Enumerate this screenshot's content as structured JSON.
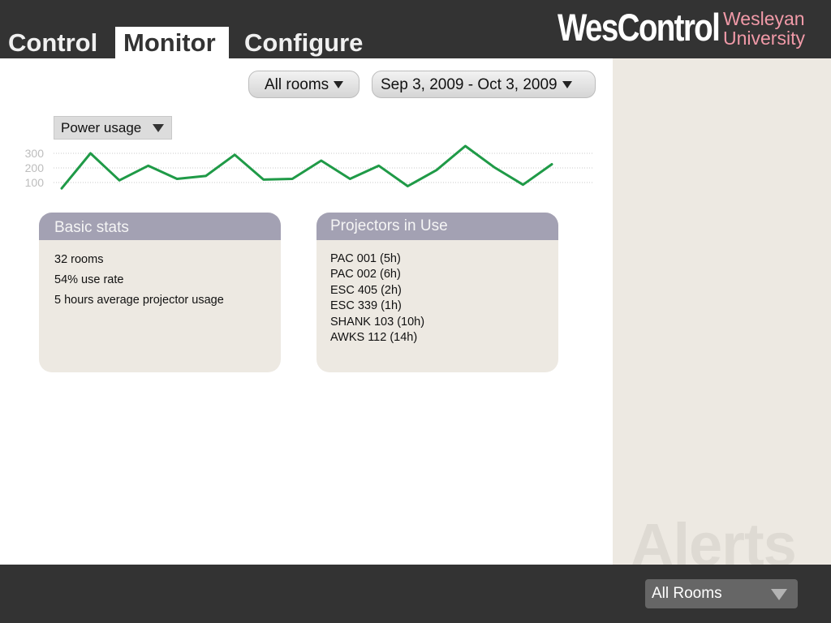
{
  "nav": {
    "tabs": [
      {
        "label": "Control"
      },
      {
        "label": "Monitor",
        "active": true
      },
      {
        "label": "Configure"
      }
    ]
  },
  "brand": {
    "name": "WesControl",
    "university_line1": "Wesleyan",
    "university_line2": "University",
    "accent_color": "#f19aa8"
  },
  "filters": {
    "rooms": "All rooms",
    "date_range": "Sep 3, 2009 - Oct 3, 2009"
  },
  "metric": {
    "selected": "Power usage"
  },
  "chart_data": {
    "type": "line",
    "title": "",
    "xlabel": "",
    "ylabel": "",
    "yticks": [
      100,
      200,
      300
    ],
    "ylim": [
      60,
      340
    ],
    "grid": true,
    "line_color": "#1f9a47",
    "series": [
      {
        "values": [
          60,
          300,
          115,
          215,
          125,
          145,
          290,
          120,
          125,
          250,
          125,
          215,
          75,
          185,
          350,
          205,
          85,
          225
        ]
      }
    ]
  },
  "basic_stats": {
    "title": "Basic stats",
    "items": [
      "32 rooms",
      "54% use rate",
      "5 hours average projector usage"
    ]
  },
  "projectors": {
    "title": "Projectors in Use",
    "items": [
      "PAC 001 (5h)",
      "PAC 002 (6h)",
      "ESC 405 (2h)",
      "ESC 339 (1h)",
      "SHANK 103 (10h)",
      "AWKS 112 (14h)"
    ]
  },
  "alerts": {
    "title": "Alerts"
  },
  "footer": {
    "room_select": "All Rooms"
  }
}
